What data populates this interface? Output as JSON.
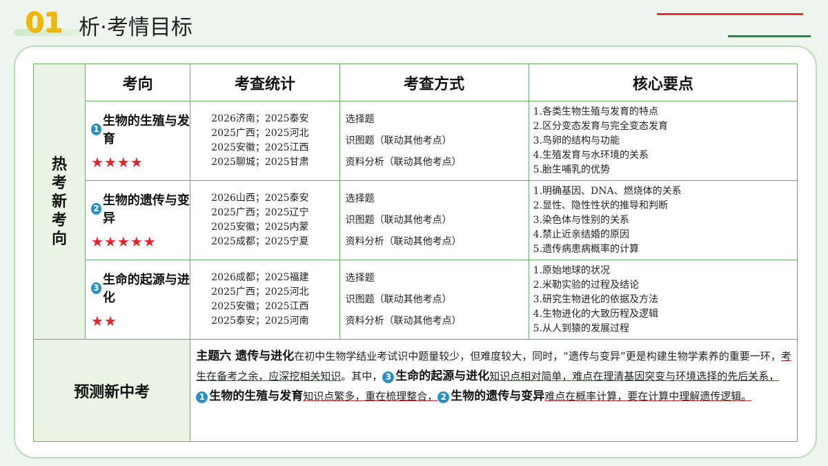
{
  "header": {
    "number": "01",
    "title": "析·考情目标"
  },
  "table": {
    "side_label": [
      "热",
      "考",
      "新",
      "考",
      "向"
    ],
    "columns": [
      "考向",
      "考查统计",
      "考查方式",
      "核心要点"
    ],
    "rows": [
      {
        "badge": "1",
        "topic": "生物的生殖与发育",
        "stars": "★★★★",
        "stats": [
          "2026济南；2025泰安",
          "2025广西；2025河北",
          "2025安徽；2025江西",
          "2025聊城；2025甘肃"
        ],
        "methods": [
          "选择题",
          "识图题（联动其他考点）",
          "资料分析（联动其他考点）"
        ],
        "keys": [
          "1.各类生物生殖与发育的特点",
          "2.区分变态发育与完全变态发育",
          "3.鸟卵的结构与功能",
          "4.生殖发育与水环境的关系",
          "5.胎生哺乳的优势"
        ]
      },
      {
        "badge": "2",
        "topic": "生物的遗传与变异",
        "stars": "★★★★★",
        "stats": [
          "2026山西；2025泰安",
          "2025广西；2025辽宁",
          "2025安徽；2025内蒙",
          "2025成都；2025宁夏"
        ],
        "methods": [
          "选择题",
          "识图题（联动其他考点）",
          "资料分析（联动其他考点）"
        ],
        "keys": [
          "1.明确基因、DNA、燃烧体的关系",
          "2.显性、隐性性状的推导和判断",
          "3.染色体与性别的关系",
          "4.禁止近亲结婚的原因",
          "5.遗传病患病概率的计算"
        ]
      },
      {
        "badge": "3",
        "topic": "生命的起源与进化",
        "stars": "★★",
        "stats": [
          "2026成都；2025福建",
          "2025广西；2025河北",
          "2025安徽；2025江西",
          "2025泰安；2025河南"
        ],
        "methods": [
          "选择题",
          "识图题（联动其他考点）",
          "资料分析（联动其他考点）"
        ],
        "keys": [
          "1.原始地球的状况",
          "2.米勒实验的过程及结论",
          "3.研究生物进化的依据及方法",
          "4.生物进化的大致历程及逻辑",
          "5.从人到猿的发展过程"
        ]
      }
    ],
    "predict": {
      "label": "预测新中考",
      "p1_bold": "主题六 遗传与进化",
      "p1_text": "在初中生物学结业考试识中题量较少，但难度较大，同时，“遗传与变异”更是构建生物学素养的重要一环，",
      "p1_red": "考生在备考之余，应深挖相关知识",
      "p2_text": "。其中，",
      "badge3": "3",
      "topic3": "生命的起源与进化",
      "t3_red": "知识点相对简单，难点在理清基因突变与环境选择的先后关系，",
      "badge1": "1",
      "topic1": "生物的生殖与发育",
      "t1_red": "知识点繁多，重在梳理整合，",
      "badge2": "2",
      "topic2": "生物的遗传与变异",
      "t2_red": "难点在概率计算，要在计算中理解遗传逻辑。"
    }
  }
}
